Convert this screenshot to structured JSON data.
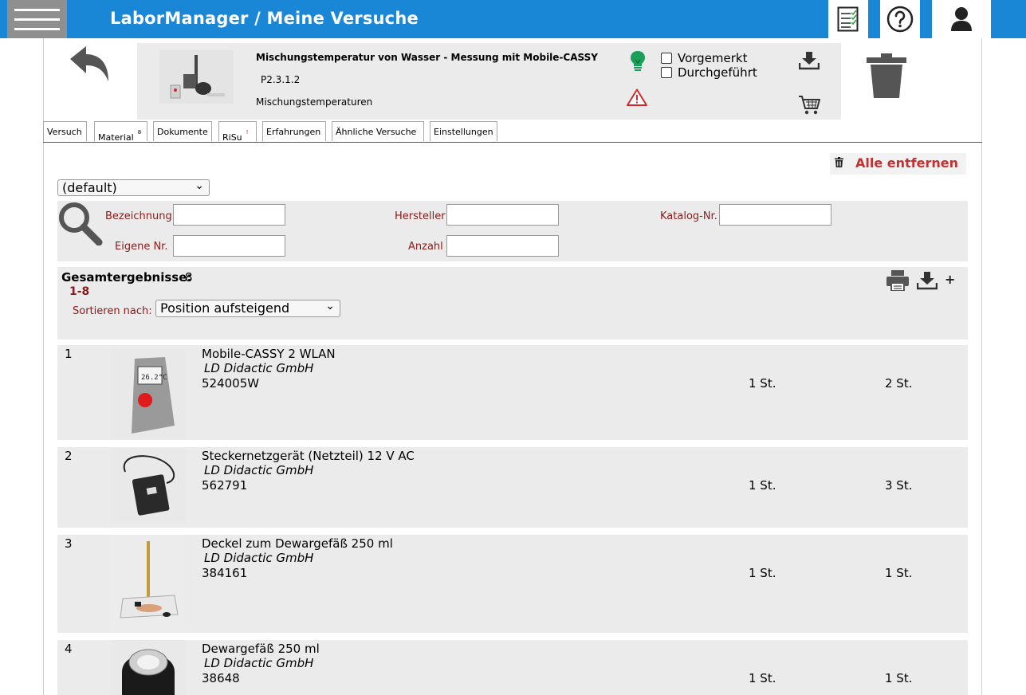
{
  "app": {
    "title": "LaborManager / Meine Versuche"
  },
  "experiment": {
    "title": "Mischungstemperatur von Wasser - Messung mit Mobile-CASSY",
    "code": "P2.3.1.2",
    "subtitle": "Mischungstemperaturen",
    "checkboxes": [
      {
        "label": "Vorgemerkt",
        "checked": false
      },
      {
        "label": "Durchgeführt",
        "checked": false
      }
    ]
  },
  "tabs": [
    {
      "label": "Versuch",
      "badge": ""
    },
    {
      "label": "Material",
      "badge": "8"
    },
    {
      "label": "Dokumente",
      "badge": ""
    },
    {
      "label": "RiSu",
      "badge": "!"
    },
    {
      "label": "Erfahrungen",
      "badge": ""
    },
    {
      "label": "Ähnliche Versuche",
      "badge": ""
    },
    {
      "label": "Einstellungen",
      "badge": ""
    }
  ],
  "toolbar": {
    "remove_all": "Alle entfernen",
    "list_select": "(default)"
  },
  "filter": {
    "bezeichnung": "Bezeichnung",
    "hersteller": "Hersteller",
    "katalog": "Katalog-Nr.",
    "eigene_nr": "Eigene Nr.",
    "anzahl": "Anzahl"
  },
  "results": {
    "total_label": "Gesamtergebnisse:",
    "total": "8",
    "range": "1-8",
    "sort_label": "Sortieren nach:",
    "sort_value": "Position aufsteigend",
    "plus": "+"
  },
  "items": [
    {
      "pos": "1",
      "name": "Mobile-CASSY 2 WLAN",
      "maker": "LD Didactic GmbH",
      "artnr": "524005W",
      "qty": "1 St.",
      "stock": "2 St."
    },
    {
      "pos": "2",
      "name": "Steckernetzgerät (Netzteil) 12 V AC",
      "maker": "LD Didactic GmbH",
      "artnr": "562791",
      "qty": "1 St.",
      "stock": "3 St."
    },
    {
      "pos": "3",
      "name": "Deckel zum Dewargefäß 250 ml",
      "maker": "LD Didactic GmbH",
      "artnr": "384161",
      "qty": "1 St.",
      "stock": "1 St."
    },
    {
      "pos": "4",
      "name": "Dewargefäß 250 ml",
      "maker": "LD Didactic GmbH",
      "artnr": "38648",
      "qty": "1 St.",
      "stock": "1 St."
    }
  ],
  "colors": {
    "topbar": "#1a86d6",
    "accent_red": "#8b1a1a",
    "remove_red": "#c53030",
    "bulb_green": "#1aa05a"
  }
}
